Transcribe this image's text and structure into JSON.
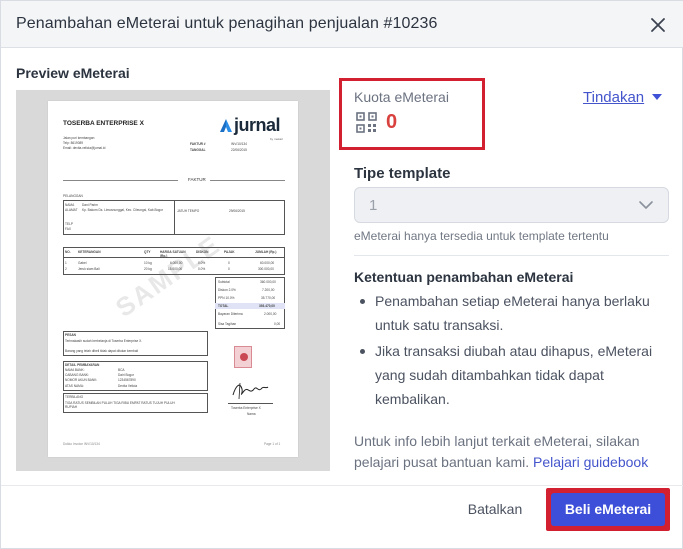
{
  "modal": {
    "title": "Penambahan eMeterai untuk penagihan penjualan #10236",
    "close_icon": "close-icon"
  },
  "preview": {
    "label": "Preview eMeterai",
    "document": {
      "company": "TOSERBA ENTERPRISE X",
      "brand": "jurnal",
      "brand_sub": "by mekari",
      "doc_title": "FAKTUR",
      "watermark": "SAMPLE",
      "address_lines": [
        "Jalan puri kembangan",
        "Telp: 8619089",
        "Email: devita.velicia@jurnal.id"
      ],
      "meta": [
        {
          "label": "FAKTUR #",
          "value": "INV/10/134"
        },
        {
          "label": "TANGGAL",
          "value": "22/06/2015"
        }
      ],
      "customer_header": "PELANGGAN",
      "customer": [
        {
          "label": "NAMA",
          "value": "Dani Parim"
        },
        {
          "label": "ALAMAT",
          "value": "Kp. Bakom Ds. Limusnunggal, Kec. Cileungsi, Kab.Bogor"
        },
        {
          "label": "TELP",
          "value": ""
        },
        {
          "label": "FAX",
          "value": ""
        }
      ],
      "due": {
        "label": "JATUH TEMPO",
        "value": "29/06/2015"
      },
      "table_headers": [
        "NO.",
        "KETERANGAN",
        "QTY",
        "HARGA SATUAN (Rp.)",
        "DISKON",
        "PAJAK",
        "JUMLAH (Rp.)"
      ],
      "table_rows": [
        [
          "1",
          "Gabel",
          "10 kg",
          "6.000,00",
          "0.0%",
          "0",
          "60.000,00"
        ],
        [
          "2",
          "Jeruk siam Bali",
          "20 kg",
          "15.000,00",
          "0.0%",
          "0",
          "300.000,00"
        ]
      ],
      "totals": [
        {
          "label": "Subtotal",
          "value": "360.000,00"
        },
        {
          "label": "Diskon 2.0%",
          "value": "7.200,00"
        },
        {
          "label": "PPN 10.0%",
          "value": "35.770,00"
        },
        {
          "label": "TOTAL",
          "value": "393.470,00"
        },
        {
          "label": "Bayaran Diterima",
          "value": "2.000,00"
        },
        {
          "label": "Sisa Tagihan",
          "value": "0,00"
        }
      ],
      "message_header": "PESAN",
      "message_lines": [
        "Terimakasih sudah berbelanja di Toserba Enterprise X.",
        "Barang yang telah dibeli tidak dapat ditukar kembali"
      ],
      "payment_header": "DETAIL PEMBAYARAN",
      "payment": [
        {
          "label": "NAMA BANK:",
          "value": "BCA"
        },
        {
          "label": "CABANG BANK:",
          "value": "Dairi Bogor"
        },
        {
          "label": "NOMOR AKUN BANK:",
          "value": "1234567890"
        },
        {
          "label": "ATAS NAMA:",
          "value": "Devita Velicia"
        }
      ],
      "terbilang_header": "TERBILANG",
      "terbilang": "TIGA RATUS SEMBILAN PULUH TIGA RIBU EMPAT RATUS TUJUH PULUH RUPIAH",
      "signature_name": "Toserba Enterprise X",
      "signature_role": "Nama",
      "footer_left": "Dokko Invoice INV/10/134",
      "footer_right": "Page 1 of 1"
    }
  },
  "quota": {
    "label": "Kuota eMeterai",
    "value": "0",
    "icon": "qr-code-icon"
  },
  "actions": {
    "label": "Tindakan"
  },
  "template": {
    "label": "Tipe template",
    "value": "1",
    "help": "eMeterai hanya tersedia untuk template tertentu"
  },
  "rules": {
    "title": "Ketentuan penambahan eMeterai",
    "items": [
      "Penambahan setiap eMeterai hanya berlaku untuk satu transaksi.",
      "Jika transaksi diubah atau dihapus, eMeterai yang sudah ditambahkan tidak dapat kembalikan."
    ]
  },
  "info": {
    "text": "Untuk info lebih lanjut terkait eMeterai, silakan pelajari pusat bantuan kami.",
    "link": "Pelajari guidebook"
  },
  "footer": {
    "cancel": "Batalkan",
    "buy": "Beli eMeterai"
  },
  "colors": {
    "accent": "#3d4fd8",
    "highlight_border": "#d32030",
    "quota_value": "#d9413e",
    "link": "#4455cc"
  }
}
